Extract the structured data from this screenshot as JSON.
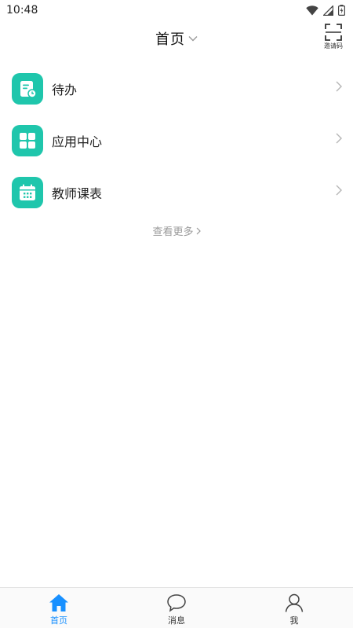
{
  "status_bar": {
    "time": "10:48",
    "icons": [
      "wifi-icon",
      "signal-icon",
      "battery-icon"
    ]
  },
  "header": {
    "title": "首页",
    "title_dropdown_icon": "chevron-down-icon",
    "invite": {
      "icon": "scan-icon",
      "label": "邀请码"
    }
  },
  "menu": {
    "items": [
      {
        "label": "待办",
        "icon": "todo-icon"
      },
      {
        "label": "应用中心",
        "icon": "apps-grid-icon"
      },
      {
        "label": "教师课表",
        "icon": "calendar-icon"
      }
    ],
    "more_label": "查看更多"
  },
  "tabbar": {
    "tabs": [
      {
        "label": "首页",
        "icon": "home-icon",
        "active": true
      },
      {
        "label": "消息",
        "icon": "message-icon",
        "active": false
      },
      {
        "label": "我",
        "icon": "user-icon",
        "active": false
      }
    ]
  },
  "colors": {
    "accent_teal": "#1fc6ac",
    "active_blue": "#1890ff",
    "muted_text": "#9a9a9a"
  }
}
